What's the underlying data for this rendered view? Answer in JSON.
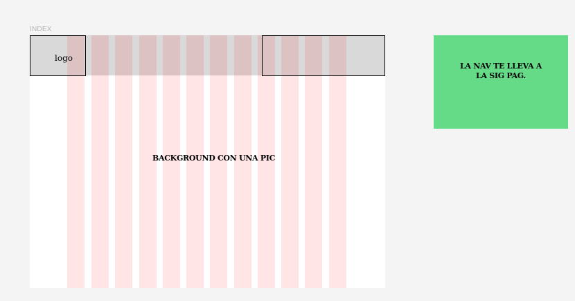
{
  "frame": {
    "label": "INDEX"
  },
  "header": {
    "logo_label": "logo"
  },
  "main": {
    "background_label": "BACKGROUND CON UNA PIC"
  },
  "note": {
    "lines": [
      "LA NAV TE LLEVA A",
      "LA SIG PAG."
    ]
  },
  "colors": {
    "canvas": "#f4f4f4",
    "frame": "#ffffff",
    "header": "#d9d9d9",
    "grid": "#fde3e3",
    "note": "#66db87",
    "outline": "#000000"
  }
}
